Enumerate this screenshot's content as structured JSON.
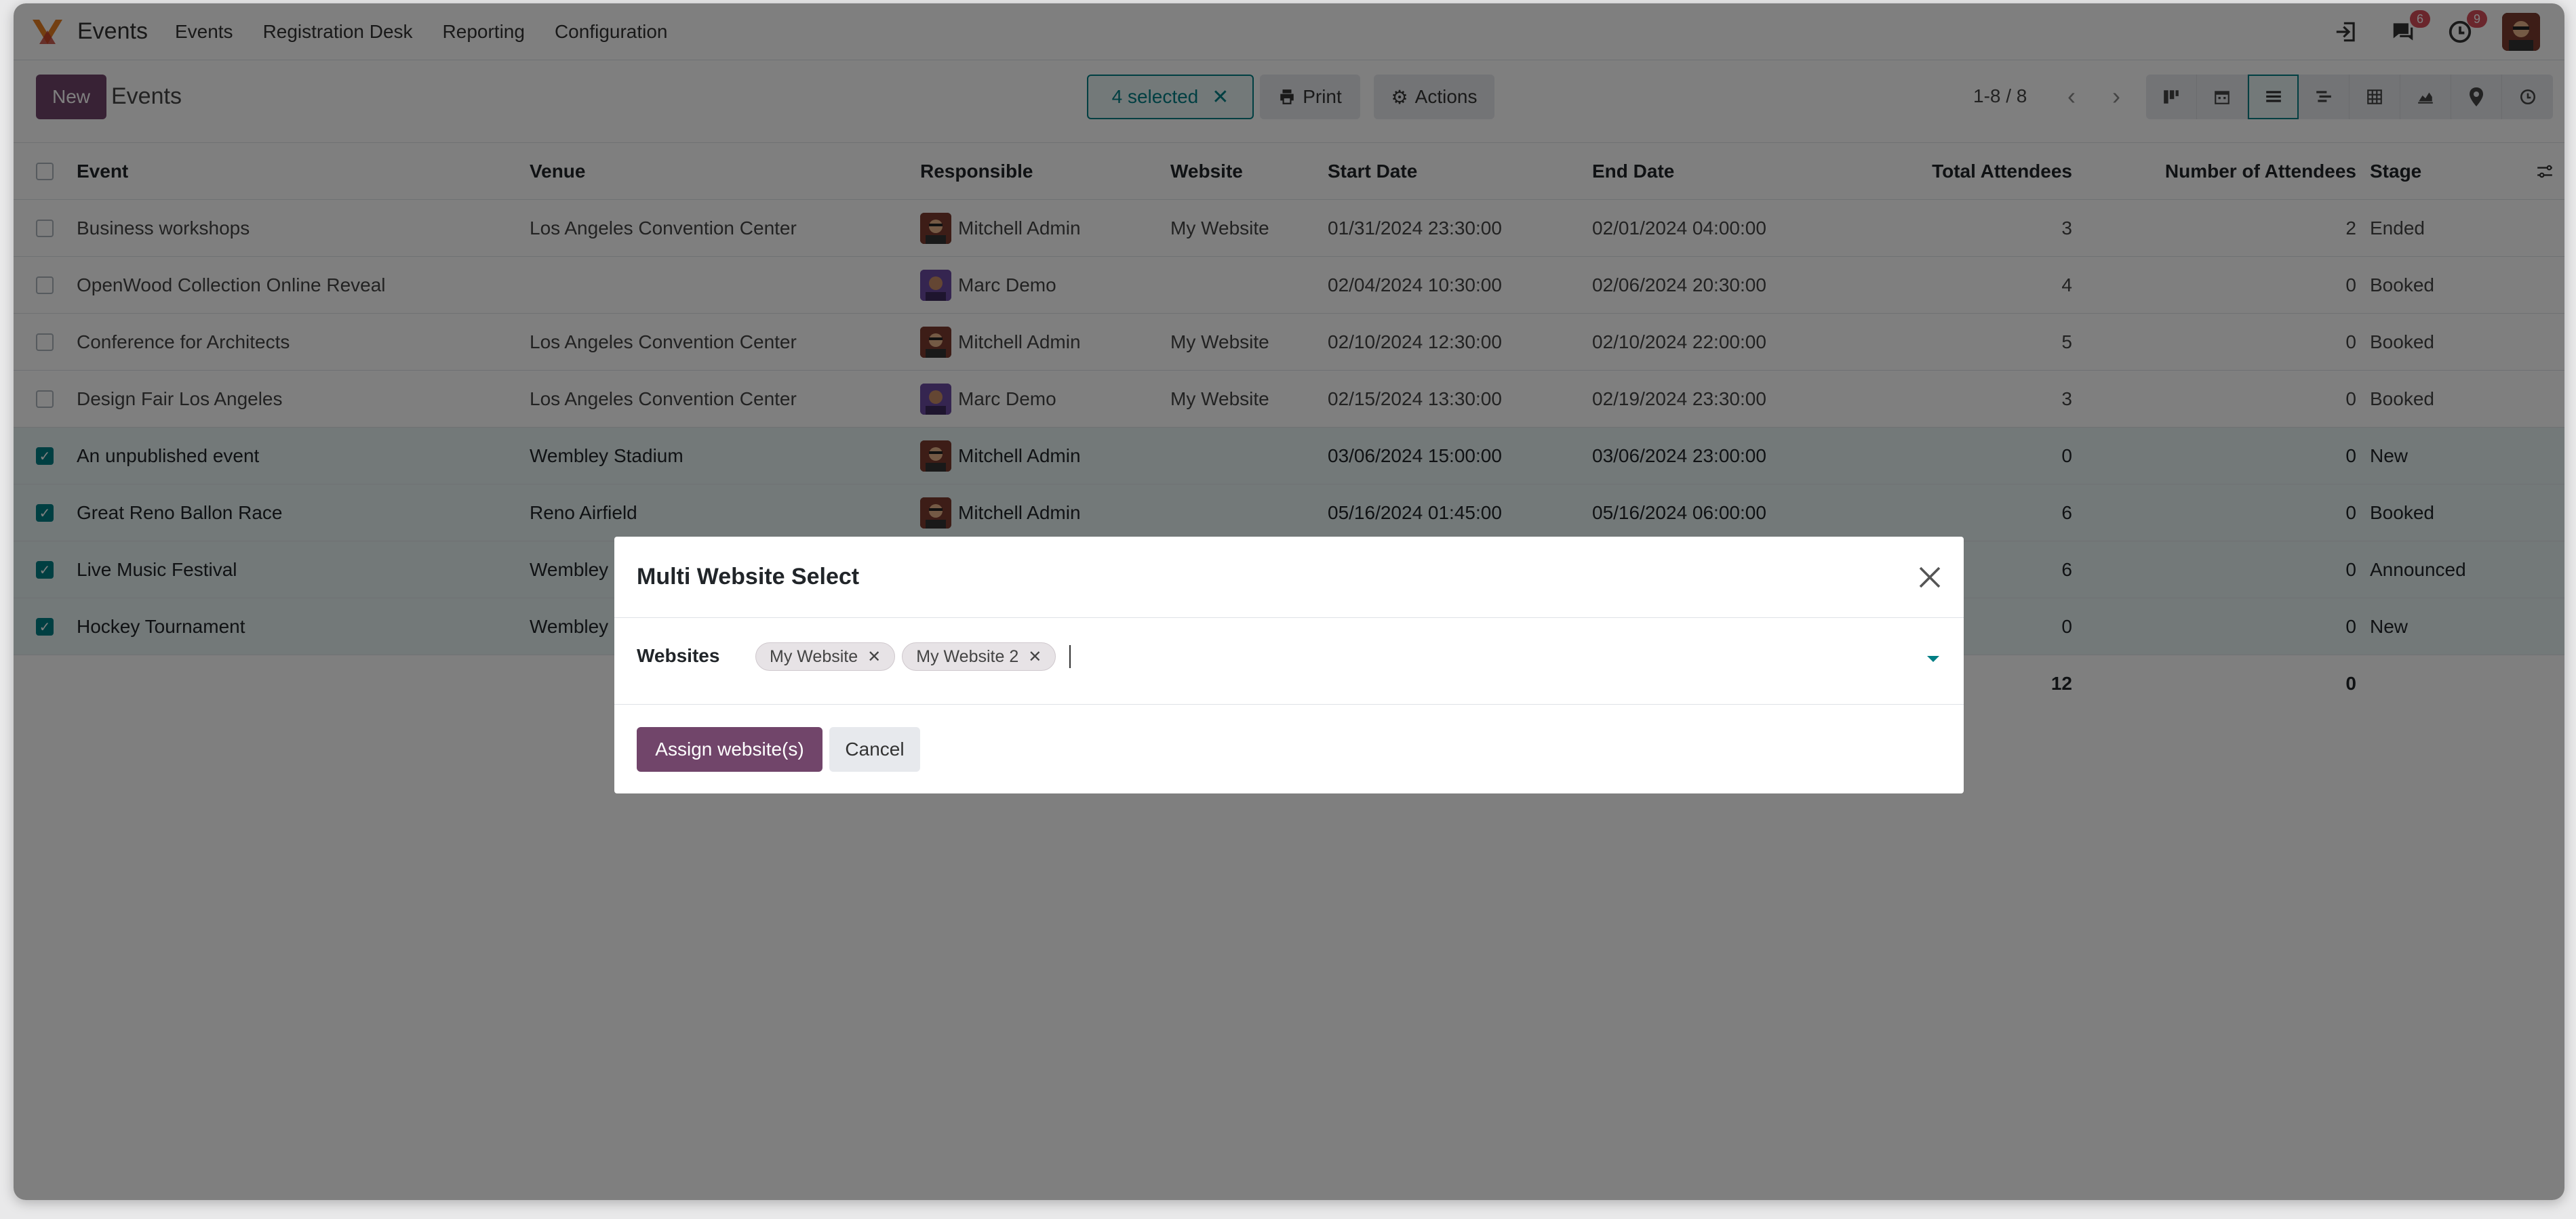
{
  "navbar": {
    "app_name": "Events",
    "menu": [
      "Events",
      "Registration Desk",
      "Reporting",
      "Configuration"
    ],
    "messages_badge": "6",
    "activity_badge": "9",
    "icons": [
      "login-icon",
      "chat-icon",
      "clock-icon"
    ]
  },
  "control": {
    "new_label": "New",
    "title": "Events",
    "selected_label": "4 selected",
    "print_label": "Print",
    "actions_label": "Actions",
    "pager": "1-8 / 8",
    "views": [
      "kanban-icon",
      "calendar-icon",
      "list-icon",
      "gantt-icon",
      "pivot-icon",
      "graph-icon",
      "map-icon",
      "activity-icon"
    ]
  },
  "table": {
    "headers": {
      "event": "Event",
      "venue": "Venue",
      "responsible": "Responsible",
      "website": "Website",
      "start": "Start Date",
      "end": "End Date",
      "total": "Total Attendees",
      "number": "Number of Attendees",
      "stage": "Stage"
    },
    "rows": [
      {
        "event": "Business workshops",
        "venue": "Los Angeles Convention Center",
        "responsible": "Mitchell Admin",
        "website": "My Website",
        "start": "01/31/2024 23:30:00",
        "end": "02/01/2024 04:00:00",
        "total": "3",
        "number": "2",
        "stage": "Ended"
      },
      {
        "event": "OpenWood Collection Online Reveal",
        "venue": "",
        "responsible": "Marc Demo",
        "website": "",
        "start": "02/04/2024 10:30:00",
        "end": "02/06/2024 20:30:00",
        "total": "4",
        "number": "0",
        "stage": "Booked"
      },
      {
        "event": "Conference for Architects",
        "venue": "Los Angeles Convention Center",
        "responsible": "Mitchell Admin",
        "website": "My Website",
        "start": "02/10/2024 12:30:00",
        "end": "02/10/2024 22:00:00",
        "total": "5",
        "number": "0",
        "stage": "Booked"
      },
      {
        "event": "Design Fair Los Angeles",
        "venue": "Los Angeles Convention Center",
        "responsible": "Marc Demo",
        "website": "My Website",
        "start": "02/15/2024 13:30:00",
        "end": "02/19/2024 23:30:00",
        "total": "3",
        "number": "0",
        "stage": "Booked"
      },
      {
        "event": "An unpublished event",
        "venue": "Wembley Stadium",
        "responsible": "Mitchell Admin",
        "website": "",
        "start": "03/06/2024 15:00:00",
        "end": "03/06/2024 23:00:00",
        "total": "0",
        "number": "0",
        "stage": "New"
      },
      {
        "event": "Great Reno Ballon Race",
        "venue": "Reno Airfield",
        "responsible": "Mitchell Admin",
        "website": "",
        "start": "05/16/2024 01:45:00",
        "end": "05/16/2024 06:00:00",
        "total": "6",
        "number": "0",
        "stage": "Booked"
      },
      {
        "event": "Live Music Festival",
        "venue": "Wembley",
        "responsible": "",
        "website": "",
        "start": "",
        "end": "",
        "total": "6",
        "number": "0",
        "stage": "Announced"
      },
      {
        "event": "Hockey Tournament",
        "venue": "Wembley",
        "responsible": "",
        "website": "",
        "start": "",
        "end": "",
        "total": "0",
        "number": "0",
        "stage": "New"
      }
    ],
    "totals": {
      "total": "12",
      "number": "0"
    }
  },
  "modal": {
    "title": "Multi Website Select",
    "field_label": "Websites",
    "tags": [
      "My Website",
      "My Website 2"
    ],
    "assign_label": "Assign website(s)",
    "cancel_label": "Cancel"
  },
  "colors": {
    "primary": "#71456a",
    "accent": "#017e84",
    "badge": "#d44c59"
  }
}
